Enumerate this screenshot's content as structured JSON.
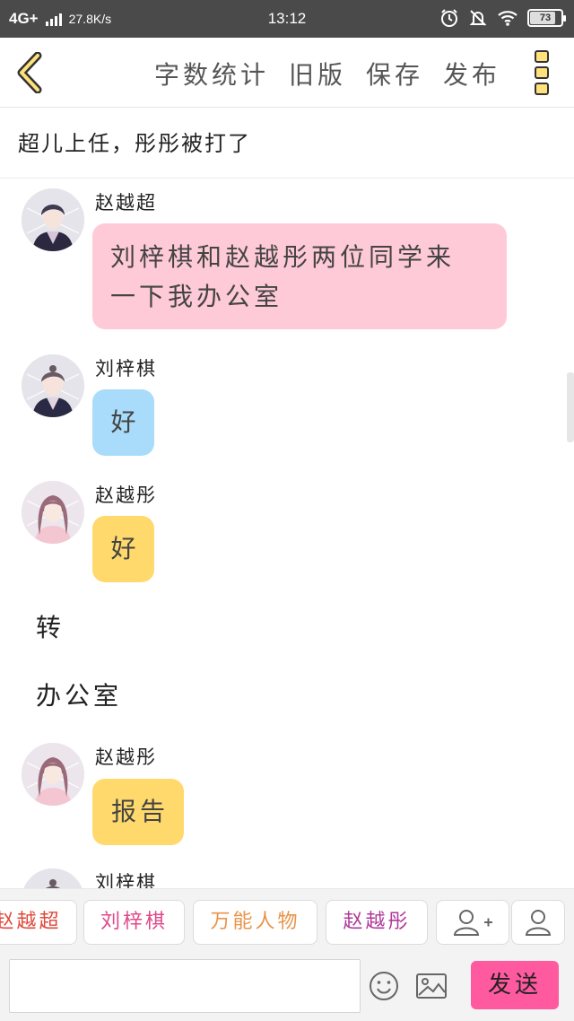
{
  "status_bar": {
    "network": "4G+",
    "speed": "27.8K/s",
    "time": "13:12",
    "battery": "73"
  },
  "toolbar": {
    "actions": [
      "字数统计",
      "旧版",
      "保存",
      "发布"
    ]
  },
  "chapter_title": "超儿上任，彤彤被打了",
  "messages": [
    {
      "speaker": "赵越超",
      "text_lines": [
        "刘梓棋和赵越彤两位同学来",
        "一下我办公室"
      ],
      "bubble_color": "#ffcad8"
    },
    {
      "speaker": "刘梓棋",
      "text": "好",
      "bubble_color": "#a8dcfa"
    },
    {
      "speaker": "赵越彤",
      "text": "好",
      "bubble_color": "#ffd96b"
    },
    {
      "narration": "转"
    },
    {
      "narration": "办公室"
    },
    {
      "speaker": "赵越彤",
      "text": "报告",
      "bubble_color": "#ffd96b"
    },
    {
      "speaker": "刘梓棋"
    }
  ],
  "role_bar": {
    "roles": [
      {
        "name": "赵越超",
        "color": "#e0483c"
      },
      {
        "name": "刘梓棋",
        "color": "#e0488a"
      },
      {
        "name": "万能人物",
        "color": "#e8944a"
      },
      {
        "name": "赵越彤",
        "color": "#b03a9a"
      }
    ]
  },
  "input": {
    "value": "",
    "placeholder": ""
  },
  "send_label": "发送",
  "colors": {
    "accent": "#ff5aa0",
    "more_icon": "#ffe27a"
  }
}
